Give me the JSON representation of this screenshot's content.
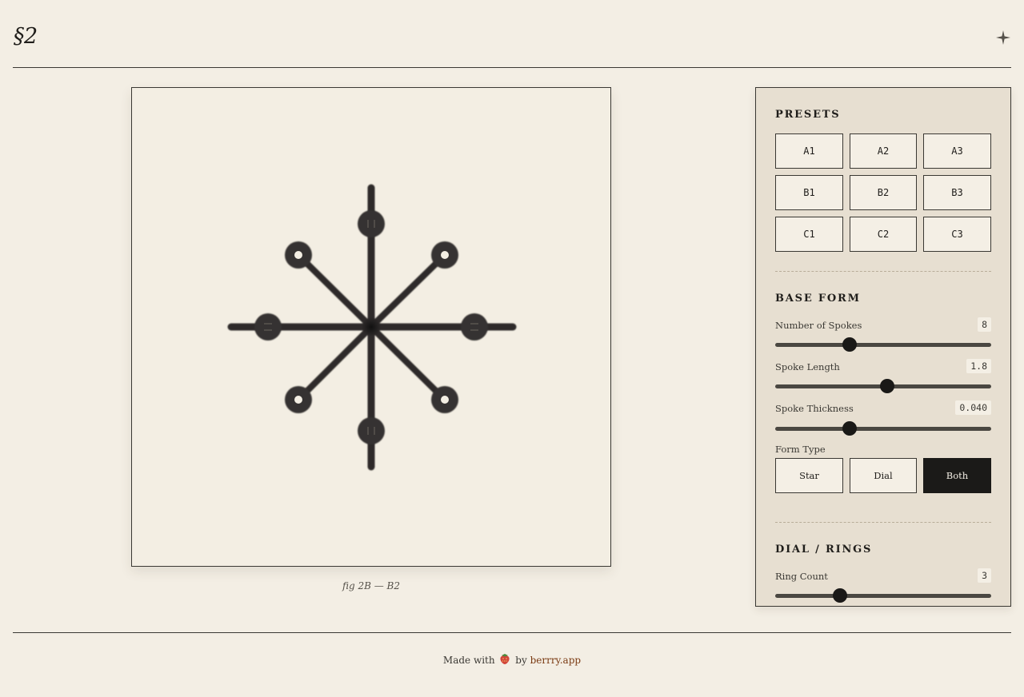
{
  "header": {
    "title": "§2",
    "icon": "sparkle-icon"
  },
  "figure": {
    "caption": "fig 2B — B2"
  },
  "panel": {
    "presets": {
      "title": "PRESETS",
      "items": [
        "A1",
        "A2",
        "A3",
        "B1",
        "B2",
        "B3",
        "C1",
        "C2",
        "C3"
      ]
    },
    "base_form": {
      "title": "BASE FORM",
      "spokes": {
        "label": "Number of Spokes",
        "value": "8",
        "position": 0.345
      },
      "length": {
        "label": "Spoke Length",
        "value": "1.8",
        "position": 0.518
      },
      "thickness": {
        "label": "Spoke Thickness",
        "value": "0.040",
        "position": 0.345
      },
      "form_type": {
        "label": "Form Type",
        "options": [
          "Star",
          "Dial",
          "Both"
        ],
        "selected": "Both"
      }
    },
    "dial": {
      "title": "DIAL / RINGS",
      "ring_count": {
        "label": "Ring Count",
        "value": "3",
        "position": 0.3
      }
    }
  },
  "footer": {
    "made_with": "Made with",
    "by": "by",
    "link": "berrry.app",
    "icon": "strawberry-icon"
  },
  "colors": {
    "ink": "#1f1d1a",
    "paper": "#f3eee4",
    "panel": "#e7dfd1",
    "active": "#1b1a18",
    "link": "#7a3a12"
  }
}
